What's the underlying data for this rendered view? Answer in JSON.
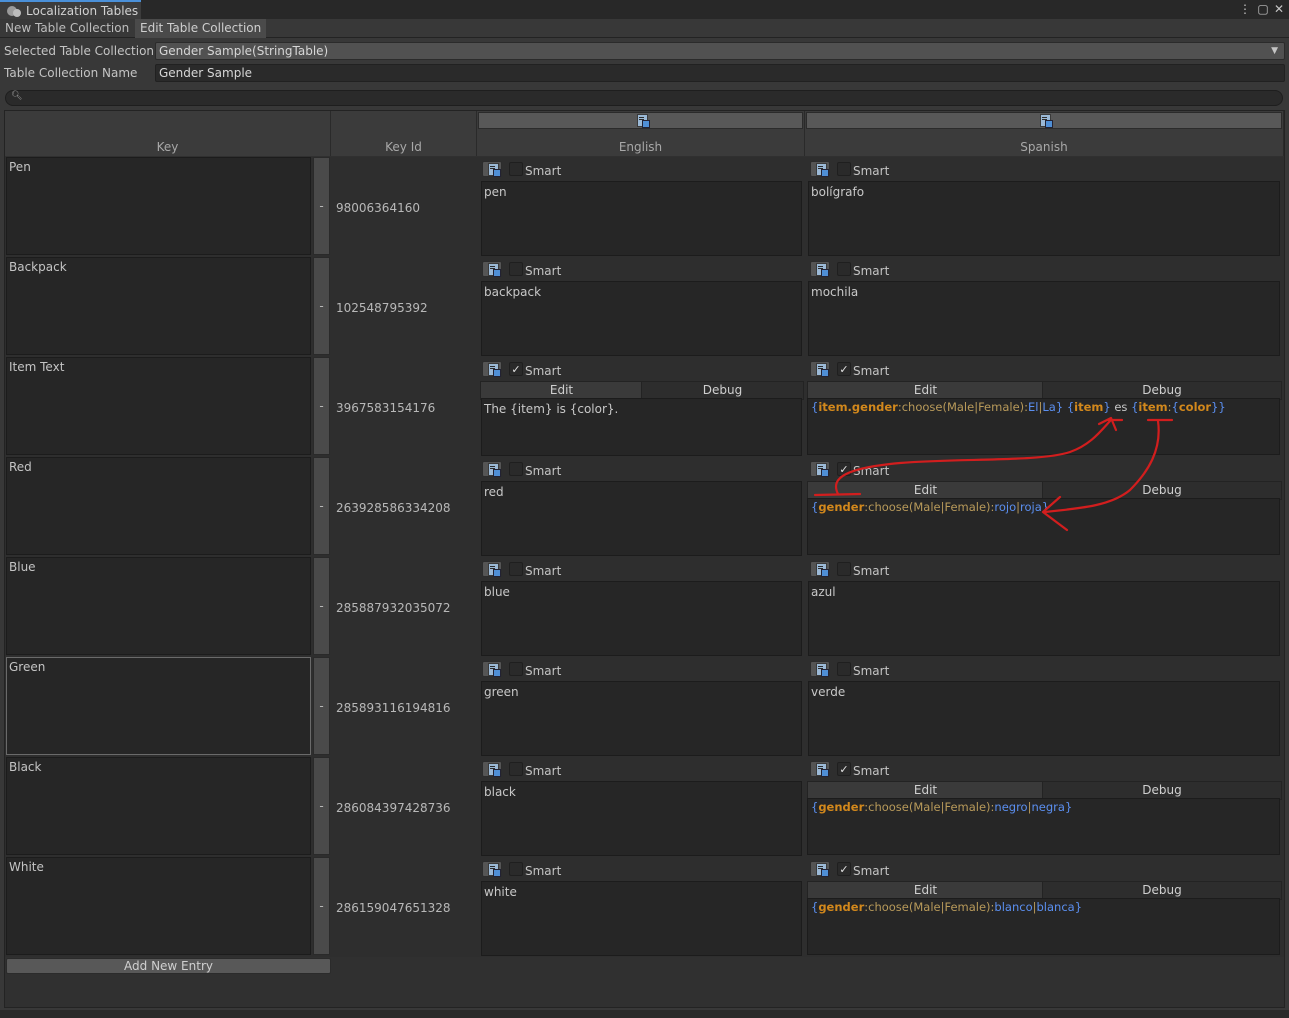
{
  "window": {
    "title": "Localization Tables"
  },
  "tabs": [
    {
      "label": "New Table Collection"
    },
    {
      "label": "Edit Table Collection"
    }
  ],
  "form": {
    "selected_label": "Selected Table Collection",
    "selected_value": "Gender Sample(StringTable)",
    "name_label": "Table Collection Name",
    "name_value": "Gender Sample"
  },
  "columns": {
    "key": "Key",
    "key_id": "Key Id",
    "english": "English",
    "spanish": "Spanish"
  },
  "labels": {
    "smart": "Smart",
    "edit": "Edit",
    "debug": "Debug",
    "minus": "-",
    "add_entry": "Add New Entry"
  },
  "rows": [
    {
      "key": "Pen",
      "id": "98006364160",
      "en": "pen",
      "en_smart": false,
      "es": "bolígrafo",
      "es_smart": false
    },
    {
      "key": "Backpack",
      "id": "102548795392",
      "en": "backpack",
      "en_smart": false,
      "es": "mochila",
      "es_smart": false
    },
    {
      "key": "Item Text",
      "id": "3967583154176",
      "en": "The {item} is {color}.",
      "en_smart": true,
      "es_smart": true
    },
    {
      "key": "Red",
      "id": "263928586334208",
      "en": "red",
      "en_smart": false,
      "es_smart": true
    },
    {
      "key": "Blue",
      "id": "285887932035072",
      "en": "blue",
      "en_smart": false,
      "es": "azul",
      "es_smart": false
    },
    {
      "key": "Green",
      "id": "285893116194816",
      "en": "green",
      "en_smart": false,
      "es": "verde",
      "es_smart": false
    },
    {
      "key": "Black",
      "id": "286084397428736",
      "en": "black",
      "en_smart": false,
      "es_smart": true
    },
    {
      "key": "White",
      "id": "286159047651328",
      "en": "white",
      "en_smart": false,
      "es_smart": true
    }
  ],
  "smart_texts": {
    "item_text": {
      "b1": "{",
      "sel1": "item.gender",
      "fmt1": ":choose(Male|Female):",
      "o1": "El",
      "s1": "|",
      "o2": "La",
      "b2": "}",
      "sp1": " ",
      "b3": "{",
      "sel2": "item",
      "b4": "}",
      "mid": " es ",
      "b5": "{",
      "sel3": "item",
      "c1": ":",
      "b6": "{",
      "sel4": "color",
      "b7": "}}"
    },
    "red": {
      "b1": "{",
      "sel": "gender",
      "fmt": ":choose(Male|Female):",
      "o1": "rojo",
      "s": "|",
      "o2": "roja",
      "b2": "}"
    },
    "black": {
      "b1": "{",
      "sel": "gender",
      "fmt": ":choose(Male|Female):",
      "o1": "negro",
      "s": "|",
      "o2": "negra",
      "b2": "}"
    },
    "white": {
      "b1": "{",
      "sel": "gender",
      "fmt": ":choose(Male|Female):",
      "o1": "blanco",
      "s": "|",
      "o2": "blanca",
      "b2": "}"
    }
  },
  "colors": {
    "annotation": "#d21e1e",
    "selector": "#d2881c",
    "brace": "#5b8ff0",
    "format": "#b89a5a"
  }
}
